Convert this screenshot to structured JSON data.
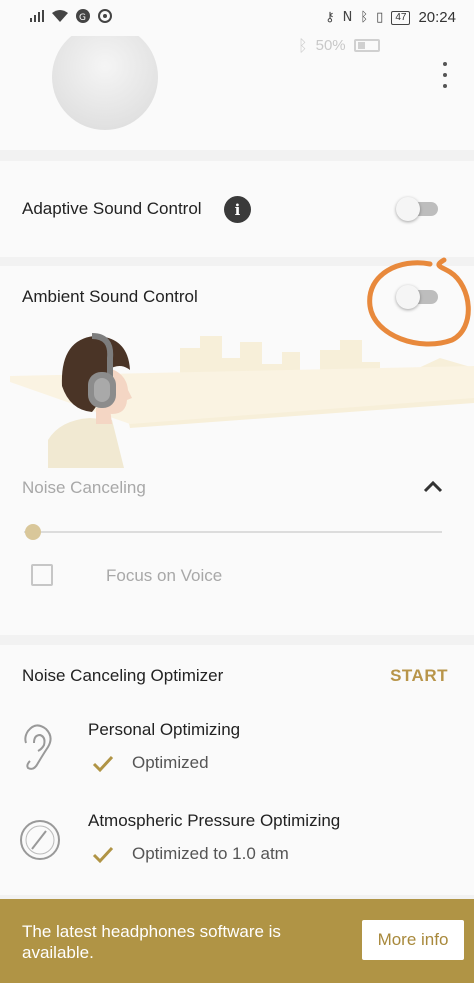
{
  "status_bar": {
    "time": "20:24",
    "battery_level": "47",
    "icons": [
      "signal-icon",
      "wifi-icon",
      "data-saver-icon",
      "sync-icon",
      "key-icon",
      "nfc-icon",
      "bluetooth-icon",
      "vibrate-icon",
      "battery-icon"
    ]
  },
  "device": {
    "battery": "50%",
    "icons": [
      "headphones-image",
      "bluetooth-icon",
      "battery-icon",
      "more-vert-icon"
    ]
  },
  "adaptive_sound_control": {
    "title": "Adaptive Sound Control",
    "enabled": false,
    "icons": [
      "info-icon"
    ]
  },
  "ambient_sound_control": {
    "title": "Ambient Sound Control",
    "enabled": false,
    "noise_canceling_label": "Noise Canceling",
    "slider_value": 0,
    "focus_on_voice_label": "Focus on Voice",
    "focus_on_voice_checked": false,
    "icons": [
      "chevron-up-icon",
      "person-headphones-illustration",
      "city-skyline-illustration"
    ]
  },
  "noise_canceling_optimizer": {
    "title": "Noise Canceling Optimizer",
    "start_label": "START",
    "items": [
      {
        "title": "Personal Optimizing",
        "status": "Optimized",
        "icon": "ear-icon"
      },
      {
        "title": "Atmospheric Pressure Optimizing",
        "status": "Optimized to 1.0 atm",
        "icon": "pressure-gauge-icon"
      }
    ]
  },
  "update_banner": {
    "message": "The latest headphones software is available.",
    "button_label": "More info"
  },
  "colors": {
    "accent": "#b09445",
    "accent_text": "#b8954a",
    "annotation_circle": "#e8893c",
    "illustration_bg": "#f7efd9"
  }
}
